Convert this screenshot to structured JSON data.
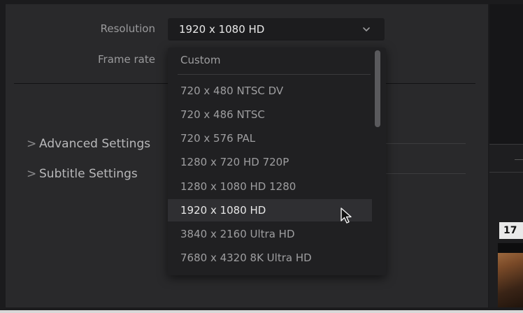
{
  "fields": {
    "resolution_label": "Resolution",
    "frame_rate_label": "Frame rate"
  },
  "resolution_select": {
    "value": "1920 x 1080 HD"
  },
  "sections": {
    "advanced": "Advanced Settings",
    "subtitle": "Subtitle Settings",
    "caret": ">"
  },
  "dropdown": {
    "items": [
      "Custom",
      "720 x 480 NTSC DV",
      "720 x 486 NTSC",
      "720 x 576 PAL",
      "1280 x 720 HD 720P",
      "1280 x 1080 HD 1280",
      "1920 x 1080 HD",
      "3840 x 2160 Ultra HD",
      "7680 x 4320 8K Ultra HD"
    ],
    "selected": "1920 x 1080 HD"
  },
  "timeline": {
    "frame_badge": "17"
  },
  "colors": {
    "panel_bg": "#29292b",
    "dropdown_bg": "#202022",
    "selected_bg": "#2f2f32",
    "text_primary": "#e8e8e8",
    "text_muted": "#9e9ea0"
  }
}
